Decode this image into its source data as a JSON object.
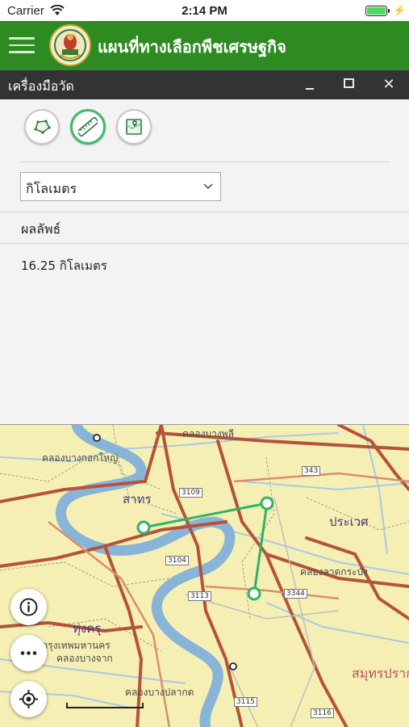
{
  "status": {
    "carrier": "Carrier",
    "time": "2:14 PM"
  },
  "app": {
    "title": "แผนที่ทางเลือกพืชเศรษฐกิจ"
  },
  "tool_window": {
    "title": "เครื่องมือวัด"
  },
  "tools": [
    {
      "name": "area-measure-icon",
      "active": false
    },
    {
      "name": "distance-measure-icon",
      "active": true
    },
    {
      "name": "location-measure-icon",
      "active": false
    }
  ],
  "unit_select": {
    "selected": "กิโลเมตร"
  },
  "result": {
    "label": "ผลลัพธ์",
    "value": "16.25 กิโลเมตร"
  },
  "map": {
    "labels": [
      {
        "text": "คลองบางกอกใหญ่",
        "cls": ""
      },
      {
        "text": "คลองบางพลี",
        "cls": ""
      },
      {
        "text": "สาทร",
        "cls": "big"
      },
      {
        "text": "ประเวศ",
        "cls": "big"
      },
      {
        "text": "คลองลาดกระบัง",
        "cls": ""
      },
      {
        "text": "ทุ่งครุ",
        "cls": "big"
      },
      {
        "text": "กรุงเทพมหานคร",
        "cls": ""
      },
      {
        "text": "คลองบางจาก",
        "cls": ""
      },
      {
        "text": "คลองบางปลากด",
        "cls": ""
      },
      {
        "text": "สมุทรปราการ",
        "cls": "red"
      }
    ],
    "route_numbers": [
      "343",
      "3109",
      "3104",
      "3113",
      "3344",
      "3115",
      "3116"
    ]
  },
  "colors": {
    "header_green": "#2e8b22",
    "measure_line": "#2db563",
    "map_bg": "#f6efb4",
    "road": "#b5533a",
    "river": "#88b4d8"
  }
}
